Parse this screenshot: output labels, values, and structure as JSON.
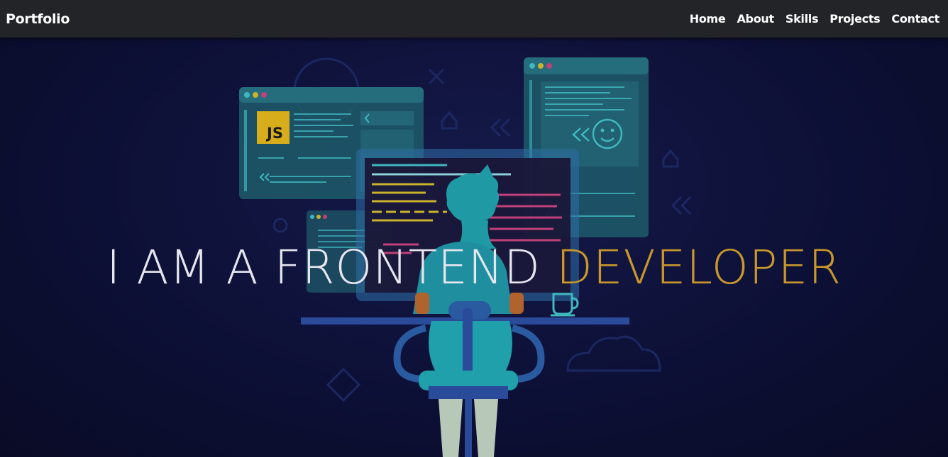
{
  "navbar": {
    "brand": "Portfolio",
    "links": [
      {
        "label": "Home"
      },
      {
        "label": "About"
      },
      {
        "label": "Skills"
      },
      {
        "label": "Projects"
      },
      {
        "label": "Contact"
      }
    ]
  },
  "hero": {
    "title_main": "I AM A FRONTEND",
    "title_accent": "DEVELOPER",
    "badge_js": "JS"
  },
  "colors": {
    "navbar_bg": "#222427",
    "hero_bg": "#0d1036",
    "accent": "#c9972c",
    "teal": "#1f6f7a"
  }
}
